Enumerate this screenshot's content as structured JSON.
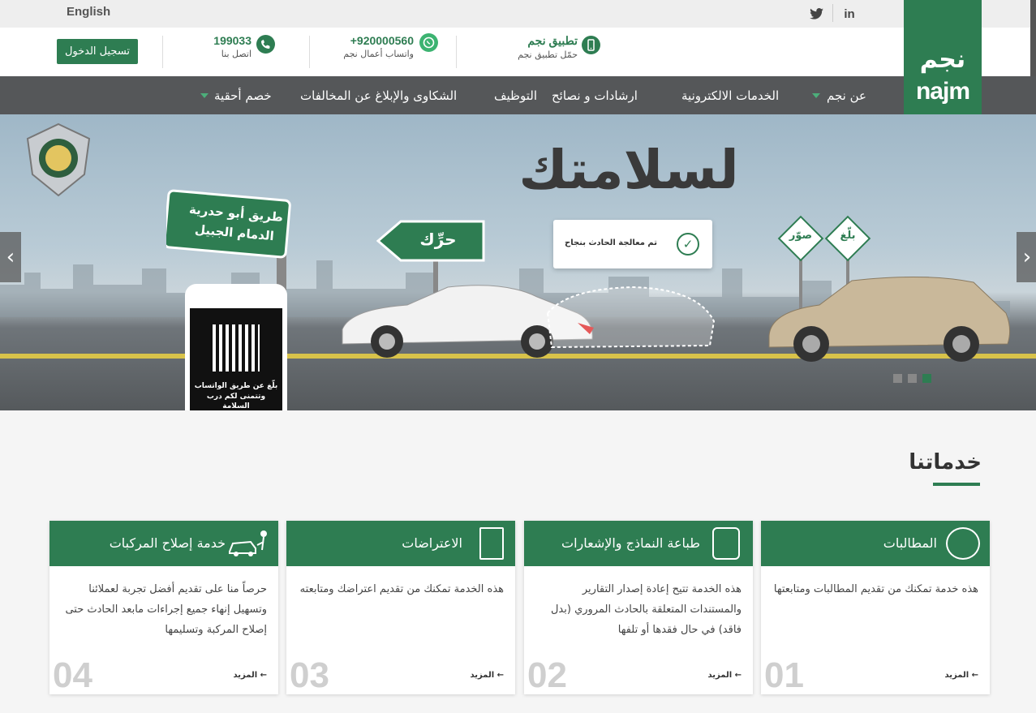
{
  "topbar": {
    "language": "English",
    "social": [
      {
        "icon": "linkedin-icon",
        "glyph": "in"
      },
      {
        "icon": "twitter-icon",
        "glyph": "🐦"
      }
    ]
  },
  "header": {
    "login_label": "تسجيل الدخول",
    "contacts": [
      {
        "icon": "phone-icon",
        "number": "199033",
        "label": "اتصل بنا"
      },
      {
        "icon": "whatsapp-icon",
        "number": "+920000560",
        "label": "واتساب أعمال نجم"
      },
      {
        "icon": "mobile-app-icon",
        "number": "تطبيق نجم",
        "label": "حمّل تطبيق نجم"
      }
    ],
    "logo_ar": "نجم",
    "logo_en": "najm"
  },
  "nav": {
    "items": [
      {
        "label": "عن نجم",
        "dropdown": true
      },
      {
        "label": "الخدمات الالكترونية",
        "dropdown": false
      },
      {
        "label": "ارشادات و نصائح",
        "dropdown": false
      },
      {
        "label": "التوظيف",
        "dropdown": false
      },
      {
        "label": "الشكاوى والإبلاغ عن المخالفات",
        "dropdown": false
      },
      {
        "label": "خصم أحقية",
        "dropdown": true
      }
    ]
  },
  "hero": {
    "title": "لسلامتك",
    "bubble_text": "تم معالجة الحادث بنجاح",
    "sign_move": "حرِّك",
    "sign_road_line1": "طريق أبو حدرية",
    "sign_road_line2": "الدمام الجبيل",
    "sign_report": "بلّغ",
    "sign_photo": "صوّر",
    "phone_text": "بلّغ عن طريق الواتساب وتتمنى لكم درب السلامة",
    "slides_total": 3,
    "active_slide": 3
  },
  "services": {
    "title": "خدماتنا",
    "more_label": "المزيد",
    "cards": [
      {
        "title": "المطالبات",
        "desc": "هذه خدمة تمكنك من تقديم المطالبات ومتابعتها",
        "num": "01",
        "icon": "claims-icon"
      },
      {
        "title": "طباعة النماذج والإشعارات",
        "desc": "هذه الخدمة تتيح إعادة إصدار التقارير والمستندات المتعلقة بالحادث المروري (بدل فاقد) في حال فقدها أو تلفها",
        "num": "02",
        "icon": "print-forms-icon"
      },
      {
        "title": "الاعتراضات",
        "desc": "هذه الخدمة تمكنك من تقديم اعتراضك ومتابعته",
        "num": "03",
        "icon": "objection-document-icon"
      },
      {
        "title": "خدمة إصلاح المركبات",
        "desc": "حرصاً منا على تقديم أفضل تجربة لعملائنا وتسهيل إنهاء جميع إجراءات مابعد الحادث حتى إصلاح المركبة وتسليمها",
        "num": "04",
        "icon": "car-repair-icon"
      }
    ]
  },
  "colors": {
    "brand_green": "#2e7d52",
    "nav_gray": "#555759"
  }
}
